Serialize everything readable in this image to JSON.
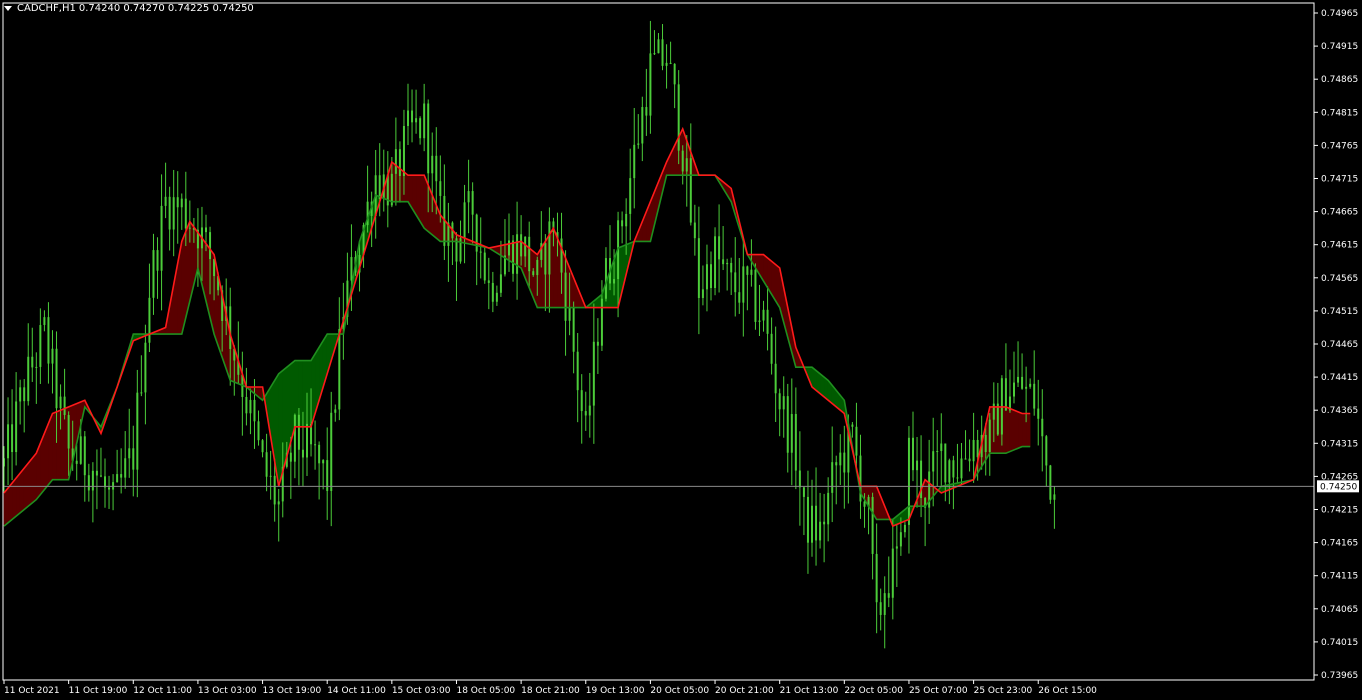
{
  "header": {
    "symbol": "CADCHF,H1",
    "ohlc": "0.74240 0.74270 0.74225 0.74250"
  },
  "current_price_label": "0.74250",
  "colors": {
    "background": "#000000",
    "candles": "#4ccd3a",
    "cloud_bull": "#005a00",
    "cloud_bear": "#5a0000",
    "line_fast": "#ff1a1a",
    "line_slow": "#1f8f1f",
    "axis": "#ffffff"
  },
  "chart_data": {
    "type": "line",
    "symbol": "CADCHF",
    "timeframe": "H1",
    "ylim": [
      0.73945,
      0.7499
    ],
    "y_ticks": [
      "0.74965",
      "0.74915",
      "0.74865",
      "0.74815",
      "0.74765",
      "0.74715",
      "0.74665",
      "0.74615",
      "0.74565",
      "0.74515",
      "0.74465",
      "0.74415",
      "0.74365",
      "0.74315",
      "0.74265",
      "0.74215",
      "0.74165",
      "0.74115",
      "0.74065",
      "0.74015",
      "0.73965"
    ],
    "x_ticks": [
      "11 Oct 2021",
      "11 Oct 19:00",
      "12 Oct 11:00",
      "13 Oct 03:00",
      "13 Oct 19:00",
      "14 Oct 11:00",
      "15 Oct 03:00",
      "18 Oct 05:00",
      "18 Oct 21:00",
      "19 Oct 13:00",
      "20 Oct 05:00",
      "20 Oct 21:00",
      "21 Oct 13:00",
      "22 Oct 05:00",
      "25 Oct 07:00",
      "25 Oct 23:00",
      "26 Oct 15:00"
    ],
    "bars_between_ticks": 16,
    "current_price": 0.7425,
    "price_anchors": [
      [
        0,
        0.7428
      ],
      [
        5,
        0.744
      ],
      [
        10,
        0.7448
      ],
      [
        16,
        0.743
      ],
      [
        22,
        0.7428
      ],
      [
        27,
        0.7422
      ],
      [
        32,
        0.743
      ],
      [
        36,
        0.7455
      ],
      [
        40,
        0.7468
      ],
      [
        44,
        0.7467
      ],
      [
        48,
        0.7464
      ],
      [
        52,
        0.7458
      ],
      [
        56,
        0.7448
      ],
      [
        60,
        0.7438
      ],
      [
        64,
        0.7428
      ],
      [
        68,
        0.7422
      ],
      [
        72,
        0.7432
      ],
      [
        76,
        0.743
      ],
      [
        80,
        0.7426
      ],
      [
        84,
        0.7452
      ],
      [
        88,
        0.7462
      ],
      [
        92,
        0.7472
      ],
      [
        96,
        0.747
      ],
      [
        100,
        0.7478
      ],
      [
        104,
        0.748
      ],
      [
        108,
        0.7465
      ],
      [
        112,
        0.7462
      ],
      [
        116,
        0.7467
      ],
      [
        120,
        0.7455
      ],
      [
        124,
        0.746
      ],
      [
        128,
        0.7462
      ],
      [
        132,
        0.7456
      ],
      [
        136,
        0.7465
      ],
      [
        140,
        0.745
      ],
      [
        144,
        0.7432
      ],
      [
        148,
        0.7455
      ],
      [
        152,
        0.7462
      ],
      [
        156,
        0.7475
      ],
      [
        160,
        0.7488
      ],
      [
        164,
        0.749
      ],
      [
        168,
        0.7476
      ],
      [
        172,
        0.7455
      ],
      [
        176,
        0.746
      ],
      [
        180,
        0.7455
      ],
      [
        184,
        0.7455
      ],
      [
        188,
        0.745
      ],
      [
        192,
        0.7438
      ],
      [
        196,
        0.743
      ],
      [
        198,
        0.742
      ],
      [
        202,
        0.7418
      ],
      [
        206,
        0.7428
      ],
      [
        210,
        0.7432
      ],
      [
        214,
        0.742
      ],
      [
        216,
        0.7404
      ],
      [
        218,
        0.741
      ],
      [
        222,
        0.7415
      ],
      [
        224,
        0.743
      ],
      [
        228,
        0.7424
      ],
      [
        232,
        0.743
      ],
      [
        236,
        0.7428
      ],
      [
        240,
        0.7432
      ],
      [
        244,
        0.7432
      ],
      [
        248,
        0.744
      ],
      [
        252,
        0.744
      ],
      [
        255,
        0.7438
      ],
      [
        258,
        0.7428
      ],
      [
        260,
        0.7424
      ]
    ],
    "series": [
      {
        "points": [
          [
            0,
            0.7424
          ],
          [
            8,
            0.743
          ],
          [
            12,
            0.7436
          ],
          [
            20,
            0.7438
          ],
          [
            24,
            0.7433
          ],
          [
            32,
            0.7447
          ],
          [
            40,
            0.7449
          ],
          [
            44,
            0.7462
          ],
          [
            46,
            0.7465
          ],
          [
            52,
            0.746
          ],
          [
            56,
            0.7448
          ],
          [
            60,
            0.744
          ],
          [
            64,
            0.744
          ],
          [
            68,
            0.7425
          ],
          [
            72,
            0.7434
          ],
          [
            76,
            0.7434
          ],
          [
            84,
            0.745
          ],
          [
            92,
            0.7466
          ],
          [
            96,
            0.7474
          ],
          [
            100,
            0.7472
          ],
          [
            104,
            0.7472
          ],
          [
            108,
            0.7466
          ],
          [
            112,
            0.7463
          ],
          [
            120,
            0.7461
          ],
          [
            128,
            0.7462
          ],
          [
            132,
            0.746
          ],
          [
            136,
            0.7464
          ],
          [
            144,
            0.7452
          ],
          [
            152,
            0.7452
          ],
          [
            156,
            0.7462
          ],
          [
            164,
            0.7474
          ],
          [
            168,
            0.7479
          ],
          [
            172,
            0.7472
          ],
          [
            176,
            0.7472
          ],
          [
            180,
            0.747
          ],
          [
            184,
            0.746
          ],
          [
            188,
            0.746
          ],
          [
            192,
            0.7458
          ],
          [
            196,
            0.7446
          ],
          [
            200,
            0.744
          ],
          [
            204,
            0.7438
          ],
          [
            208,
            0.7436
          ],
          [
            212,
            0.7425
          ],
          [
            216,
            0.7425
          ],
          [
            220,
            0.7419
          ],
          [
            224,
            0.742
          ],
          [
            228,
            0.7426
          ],
          [
            232,
            0.7424
          ],
          [
            240,
            0.7426
          ],
          [
            244,
            0.7437
          ],
          [
            248,
            0.7437
          ],
          [
            252,
            0.7436
          ],
          [
            254,
            0.7436
          ]
        ]
      },
      {
        "points": [
          [
            0,
            0.7419
          ],
          [
            8,
            0.7423
          ],
          [
            12,
            0.7426
          ],
          [
            16,
            0.7426
          ],
          [
            20,
            0.7437
          ],
          [
            24,
            0.7434
          ],
          [
            28,
            0.744
          ],
          [
            32,
            0.7448
          ],
          [
            40,
            0.7448
          ],
          [
            44,
            0.7448
          ],
          [
            48,
            0.7458
          ],
          [
            52,
            0.7448
          ],
          [
            56,
            0.7441
          ],
          [
            60,
            0.744
          ],
          [
            64,
            0.7438
          ],
          [
            68,
            0.7442
          ],
          [
            72,
            0.7444
          ],
          [
            76,
            0.7444
          ],
          [
            80,
            0.7448
          ],
          [
            84,
            0.7448
          ],
          [
            88,
            0.7462
          ],
          [
            92,
            0.7469
          ],
          [
            96,
            0.7468
          ],
          [
            100,
            0.7468
          ],
          [
            104,
            0.7464
          ],
          [
            108,
            0.7462
          ],
          [
            112,
            0.7462
          ],
          [
            120,
            0.7461
          ],
          [
            128,
            0.7458
          ],
          [
            132,
            0.7452
          ],
          [
            136,
            0.7452
          ],
          [
            140,
            0.7452
          ],
          [
            144,
            0.7452
          ],
          [
            148,
            0.7454
          ],
          [
            152,
            0.7461
          ],
          [
            156,
            0.7462
          ],
          [
            160,
            0.7462
          ],
          [
            164,
            0.7472
          ],
          [
            168,
            0.7472
          ],
          [
            172,
            0.7472
          ],
          [
            176,
            0.7472
          ],
          [
            180,
            0.7468
          ],
          [
            184,
            0.746
          ],
          [
            188,
            0.7456
          ],
          [
            192,
            0.7452
          ],
          [
            196,
            0.7443
          ],
          [
            200,
            0.7443
          ],
          [
            204,
            0.7441
          ],
          [
            208,
            0.7438
          ],
          [
            212,
            0.7424
          ],
          [
            216,
            0.742
          ],
          [
            220,
            0.742
          ],
          [
            224,
            0.7422
          ],
          [
            228,
            0.7422
          ],
          [
            232,
            0.7425
          ],
          [
            240,
            0.7426
          ],
          [
            244,
            0.743
          ],
          [
            248,
            0.743
          ],
          [
            252,
            0.7431
          ],
          [
            254,
            0.7431
          ]
        ]
      }
    ]
  }
}
